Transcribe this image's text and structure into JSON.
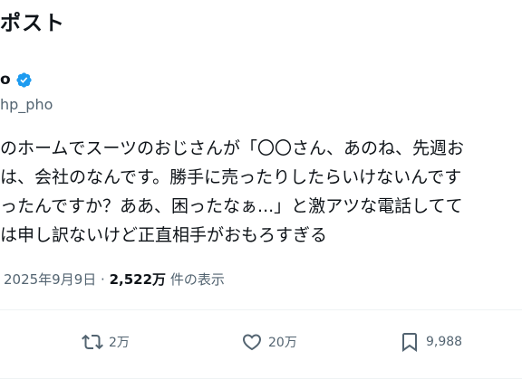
{
  "header": {
    "title": "ポスト"
  },
  "author": {
    "display_name": "o",
    "handle": "hp_pho",
    "verified_color": "#1d9bf0"
  },
  "post": {
    "lines": [
      "のホームでスーツのおじさんが「〇〇さん、あのね、先週お",
      "は、会社のなんです。勝手に売ったりしたらいけないんです",
      "ったんですか？ああ、困ったなぁ...」と激アツな電話してて",
      "は申し訳ないけど正直相手がおもろすぎる"
    ]
  },
  "meta": {
    "date": "2025年9月9日",
    "separator": "·",
    "views_count": "2,522万",
    "views_label": "件の表示"
  },
  "actions": {
    "retweets": "2万",
    "likes": "20万",
    "bookmarks": "9,988"
  },
  "icons": {
    "retweet": "retweet-icon",
    "like": "heart-icon",
    "bookmark": "bookmark-icon",
    "verified": "verified-badge-icon"
  },
  "colors": {
    "text": "#0f1419",
    "secondary": "#536471",
    "accent": "#1d9bf0"
  }
}
